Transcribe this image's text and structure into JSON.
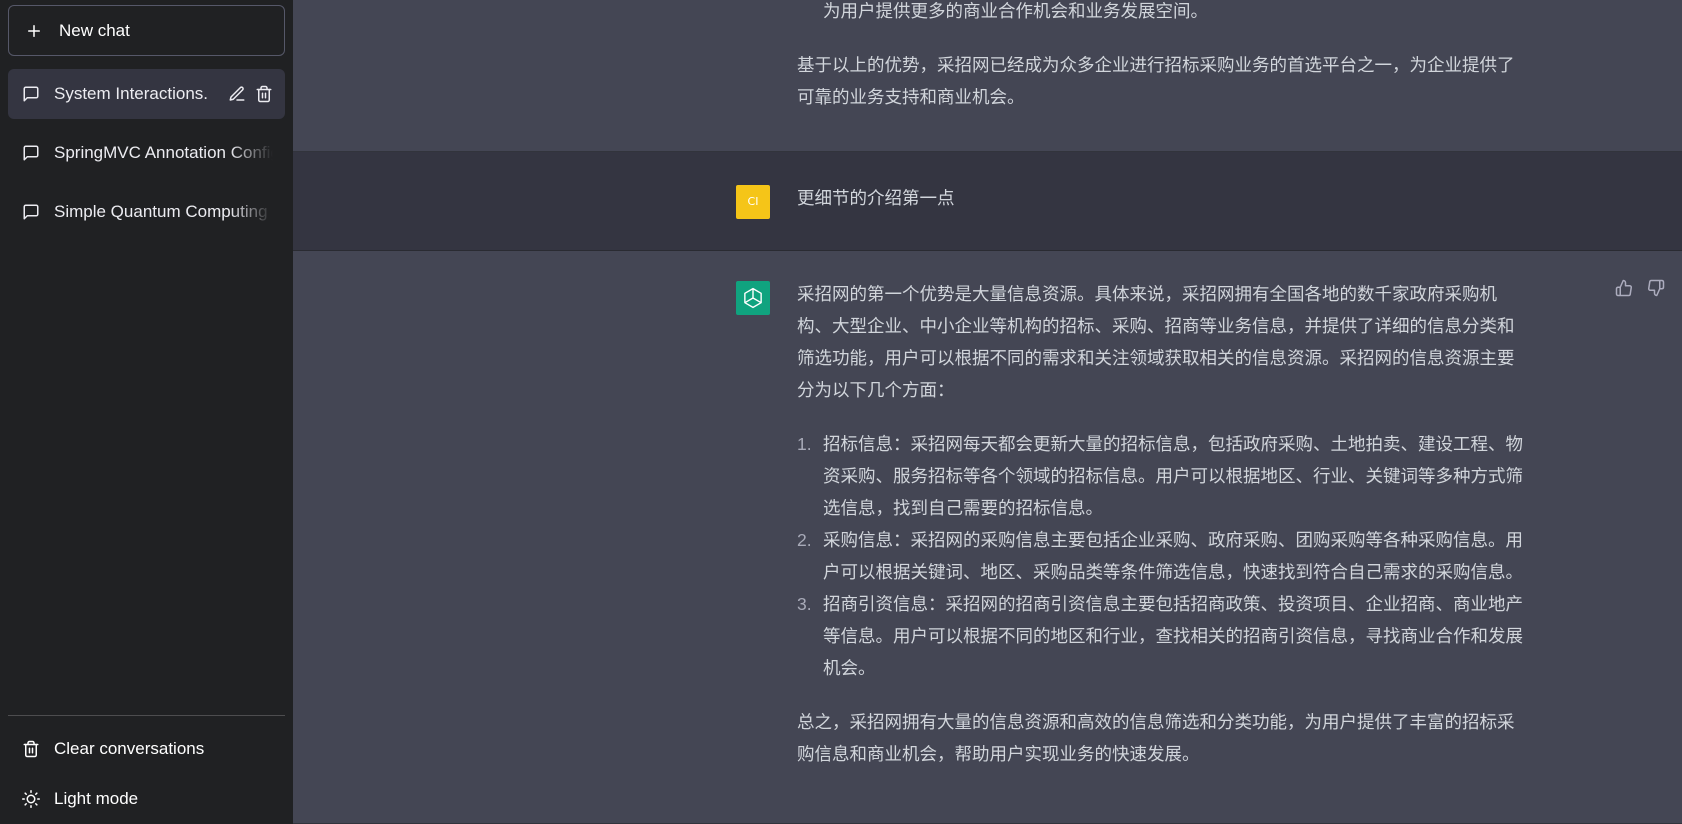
{
  "sidebar": {
    "new_chat_label": "New chat",
    "conversations": [
      {
        "label": "System Interactions.",
        "active": true
      },
      {
        "label": "SpringMVC Annotation Configuration",
        "active": false
      },
      {
        "label": "Simple Quantum Computing",
        "active": false
      }
    ],
    "bottom_items": [
      {
        "label": "Clear conversations",
        "icon": "trash-icon"
      },
      {
        "label": "Light mode",
        "icon": "sun-icon"
      }
    ]
  },
  "chat": {
    "prev_answer": {
      "tail_line": "为用户提供更多的商业合作机会和业务发展空间。",
      "summary": "基于以上的优势，采招网已经成为众多企业进行招标采购业务的首选平台之一，为企业提供了可靠的业务支持和商业机会。"
    },
    "user_message": {
      "avatar_text": "CI",
      "text": "更细节的介绍第一点"
    },
    "answer": {
      "intro": "采招网的第一个优势是大量信息资源。具体来说，采招网拥有全国各地的数千家政府采购机构、大型企业、中小企业等机构的招标、采购、招商等业务信息，并提供了详细的信息分类和筛选功能，用户可以根据不同的需求和关注领域获取相关的信息资源。采招网的信息资源主要分为以下几个方面：",
      "items": [
        {
          "num": "1.",
          "text": "招标信息：采招网每天都会更新大量的招标信息，包括政府采购、土地拍卖、建设工程、物资采购、服务招标等各个领域的招标信息。用户可以根据地区、行业、关键词等多种方式筛选信息，找到自己需要的招标信息。"
        },
        {
          "num": "2.",
          "text": "采购信息：采招网的采购信息主要包括企业采购、政府采购、团购采购等各种采购信息。用户可以根据关键词、地区、采购品类等条件筛选信息，快速找到符合自己需求的采购信息。"
        },
        {
          "num": "3.",
          "text": "招商引资信息：采招网的招商引资信息主要包括招商政策、投资项目、企业招商、商业地产等信息。用户可以根据不同的地区和行业，查找相关的招商引资信息，寻找商业合作和发展机会。"
        }
      ],
      "conclusion": "总之，采招网拥有大量的信息资源和高效的信息筛选和分类功能，为用户提供了丰富的招标采购信息和商业机会，帮助用户实现业务的快速发展。"
    }
  },
  "colors": {
    "sidebar_bg": "#202123",
    "user_bg": "#343541",
    "assistant_bg": "#444654",
    "gpt_avatar": "#10a37f",
    "user_avatar": "#f5c518"
  }
}
